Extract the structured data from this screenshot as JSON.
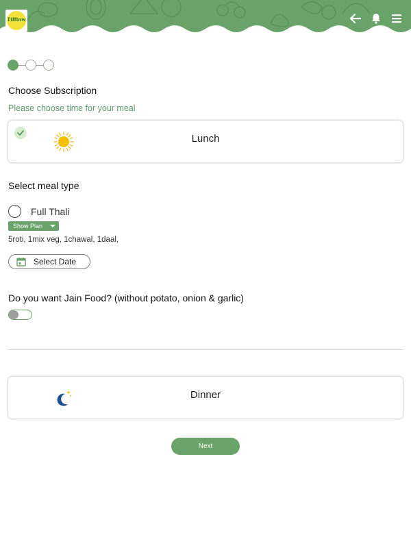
{
  "header": {
    "logo_text": "Tiffinwala",
    "bg_color": "#6aa36a",
    "icons": [
      "back-arrow-icon",
      "bell-icon",
      "menu-icon"
    ]
  },
  "stepper": {
    "total_steps": 3,
    "current_step": 1
  },
  "page": {
    "title": "Choose Subscription",
    "subtitle": "Please choose time for your meal"
  },
  "lunch_card": {
    "label": "Lunch",
    "selected": true,
    "icon": "sun-icon"
  },
  "meal_type": {
    "section_label": "Select meal type",
    "option_label": "Full Thali",
    "show_plan_label": "Show Plan",
    "plan_description": "5roti, 1mix veg, 1chawal, 1daal,",
    "select_date_label": "Select Date"
  },
  "jain": {
    "question": "Do you want Jain Food? (without potato, onion & garlic)",
    "enabled": false
  },
  "dinner_card": {
    "label": "Dinner",
    "selected": false,
    "icon": "moon-icon"
  },
  "actions": {
    "next_label": "Next"
  },
  "colors": {
    "accent": "#6aa36a",
    "subtitle": "#5e9a6e"
  }
}
